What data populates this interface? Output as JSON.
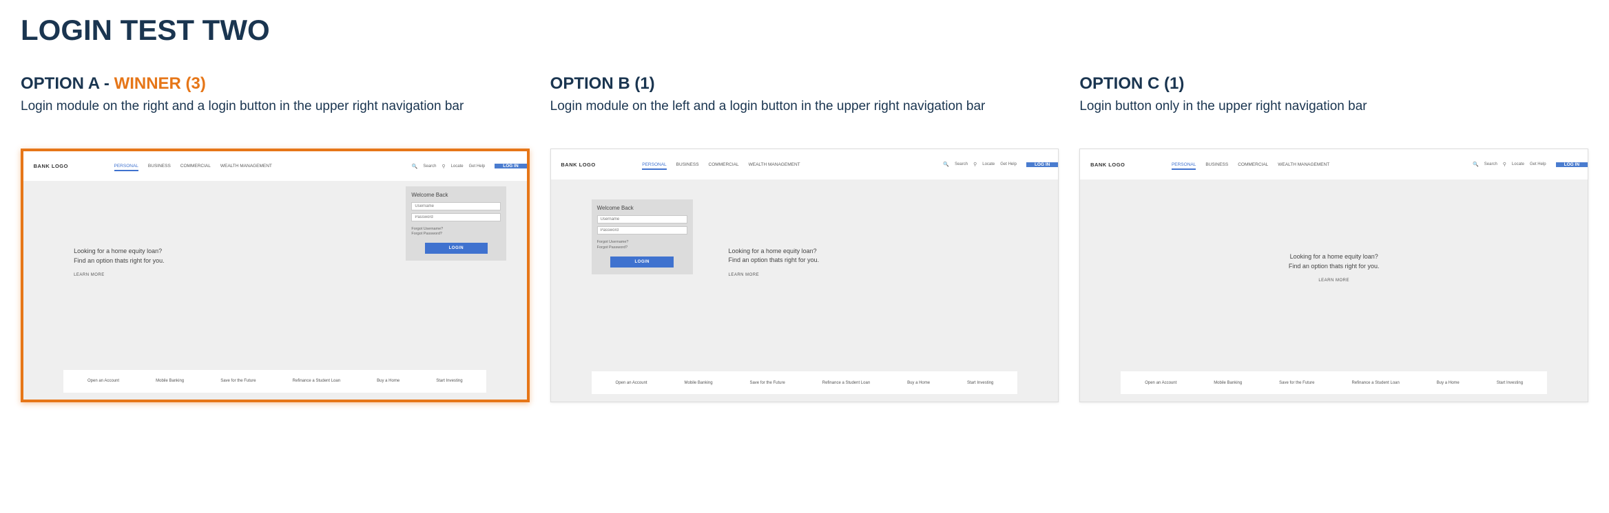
{
  "page_title": "LOGIN TEST TWO",
  "options": {
    "a": {
      "label": "OPTION A - ",
      "winner_label": "WINNER (3)",
      "is_winner": true,
      "desc": "Login module on the right and a login button in the upper right navigation bar"
    },
    "b": {
      "label": "OPTION B (1)",
      "desc": "Login module on the left and a login button in the upper right navigation bar"
    },
    "c": {
      "label": "OPTION C (1)",
      "desc": "Login button only in the upper right navigation bar"
    }
  },
  "mock": {
    "logo": "BANK LOGO",
    "nav_tabs": {
      "t0": "PERSONAL",
      "t1": "BUSINESS",
      "t2": "COMMERCIAL",
      "t3": "WEALTH MANAGEMENT"
    },
    "nav_right": {
      "search": "Search",
      "locate": "Locate",
      "help": "Get Help"
    },
    "login_btn": "LOG IN",
    "hero": {
      "line1": "Looking for a home equity loan?",
      "line2": "Find an option thats right for you.",
      "learn_more": "LEARN MORE"
    },
    "login_module": {
      "welcome": "Welcome Back",
      "username_ph": "Username",
      "password_ph": "Password",
      "forgot_user": "Forgot Username?",
      "forgot_pass": "Forgot Password?",
      "submit": "LOGIN"
    },
    "footer_links": {
      "f0": "Open an Account",
      "f1": "Mobile Banking",
      "f2": "Save for the Future",
      "f3": "Refinance a Student Loan",
      "f4": "Buy a Home",
      "f5": "Start Investing"
    }
  }
}
